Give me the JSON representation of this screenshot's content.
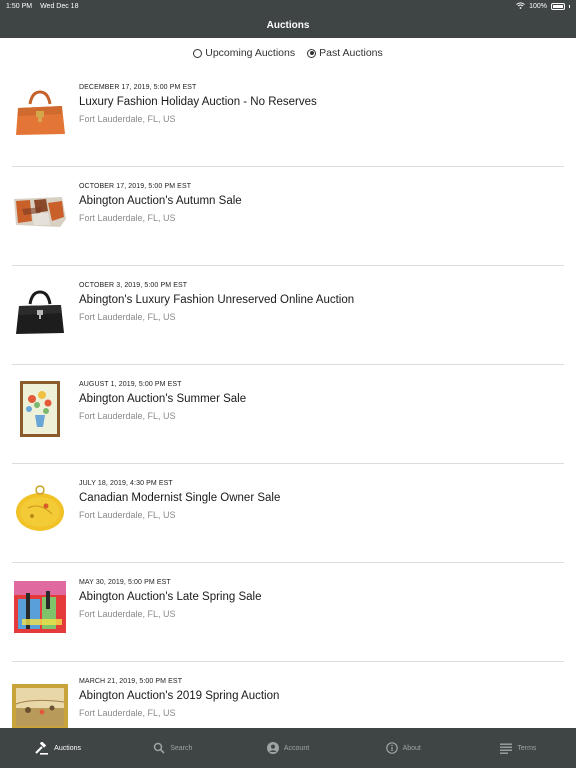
{
  "status": {
    "time": "1:50 PM",
    "date": "Wed Dec 18",
    "battery": "100%"
  },
  "header": {
    "title": "Auctions"
  },
  "filter": {
    "options": [
      {
        "label": "Upcoming Auctions",
        "selected": false
      },
      {
        "label": "Past Auctions",
        "selected": true
      }
    ]
  },
  "auctions": [
    {
      "date": "DECEMBER 17, 2019, 5:00 PM EST",
      "title": "Luxury Fashion Holiday Auction - No Reserves",
      "location": "Fort Lauderdale, FL, US",
      "image": "orange-handbag"
    },
    {
      "date": "OCTOBER 17, 2019, 5:00 PM EST",
      "title": "Abington Auction's Autumn Sale",
      "location": "Fort Lauderdale, FL, US",
      "image": "patterned-box"
    },
    {
      "date": "OCTOBER 3, 2019, 5:00 PM EST",
      "title": "Abington's Luxury Fashion Unreserved Online Auction",
      "location": "Fort Lauderdale, FL, US",
      "image": "black-handbag"
    },
    {
      "date": "AUGUST 1, 2019, 5:00 PM EST",
      "title": "Abington Auction's Summer Sale",
      "location": "Fort Lauderdale, FL, US",
      "image": "flower-painting"
    },
    {
      "date": "JULY 18, 2019, 4:30 PM EST",
      "title": "Canadian Modernist Single Owner Sale",
      "location": "Fort Lauderdale, FL, US",
      "image": "gold-brooch"
    },
    {
      "date": "MAY 30, 2019, 5:00 PM EST",
      "title": "Abington Auction's Late Spring Sale",
      "location": "Fort Lauderdale, FL, US",
      "image": "pop-art-print"
    },
    {
      "date": "MARCH 21, 2019, 5:00 PM EST",
      "title": "Abington Auction's 2019 Spring Auction",
      "location": "Fort Lauderdale, FL, US",
      "image": "framed-landscape"
    }
  ],
  "tabs": [
    {
      "label": "Auctions",
      "icon": "gavel-icon",
      "active": true
    },
    {
      "label": "Search",
      "icon": "search-icon",
      "active": false
    },
    {
      "label": "Account",
      "icon": "account-icon",
      "active": false
    },
    {
      "label": "About",
      "icon": "info-icon",
      "active": false
    },
    {
      "label": "Terms",
      "icon": "list-icon",
      "active": false
    }
  ]
}
